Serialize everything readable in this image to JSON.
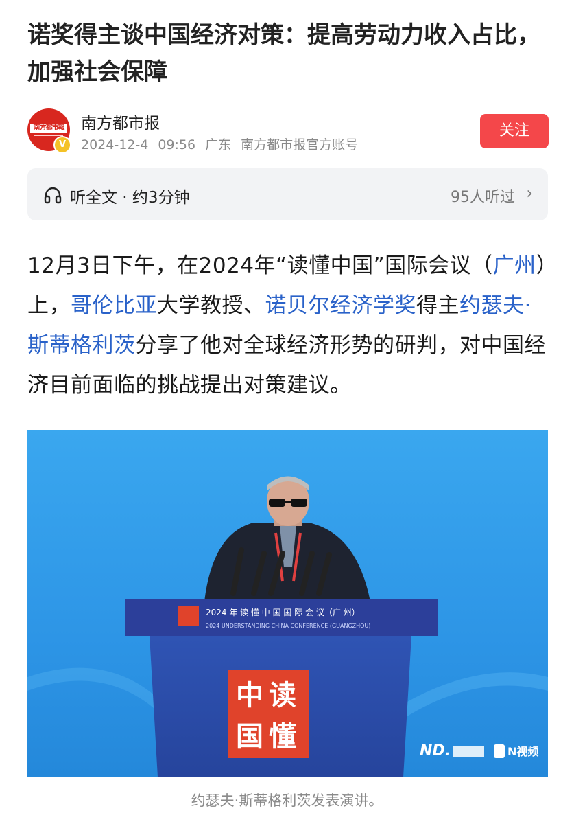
{
  "article": {
    "title": "诺奖得主谈中国经济对策：提高劳动力收入占比，加强社会保障"
  },
  "author": {
    "avatar_text": "南方都市報",
    "name": "南方都市报",
    "date": "2024-12-4",
    "time": "09:56",
    "location": "广东",
    "account": "南方都市报官方账号",
    "follow_label": "关注",
    "verified_badge": "V"
  },
  "audio": {
    "label": "听全文 · 约3分钟",
    "listeners": "95人听过",
    "chevron": "›",
    "icon": "headphone-icon"
  },
  "body": {
    "p1_a": "12月3日下午，在2024年“读懂中国”国际会议（",
    "p1_link1": "广州",
    "p1_b": "）上，",
    "p1_link2": "哥伦比亚",
    "p1_c": "大学教授、",
    "p1_link3": "诺贝尔经济学奖",
    "p1_d": "得主",
    "p1_link4": "约瑟夫·斯蒂格利茨",
    "p1_e": "分享了他对全球经济形势的研判，对中国经济目前面临的挑战提出对策建议。"
  },
  "photo": {
    "banner_cn": "2024 年 读 懂 中 国 国 际 会 议（广 州）",
    "banner_en": "2024 UNDERSTANDING CHINA CONFERENCE (GUANGZHOU)",
    "logo_chars": [
      "中",
      "读",
      "国",
      "懂"
    ],
    "watermark_nd": "ND.",
    "watermark_video": "N视频",
    "caption": "约瑟夫·斯蒂格利茨发表演讲。"
  },
  "colors": {
    "accent": "#f4474a",
    "link": "#2a62c9",
    "brand_red": "#d8271f"
  }
}
